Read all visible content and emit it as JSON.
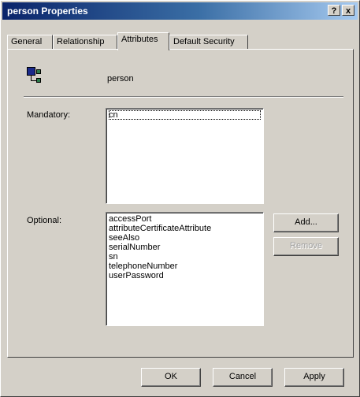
{
  "window": {
    "title": "person Properties",
    "help_button": "?",
    "close_button": "x"
  },
  "tabs": [
    {
      "label": "General"
    },
    {
      "label": "Relationship"
    },
    {
      "label": "Attributes"
    },
    {
      "label": "Default Security"
    }
  ],
  "active_tab": "Attributes",
  "class_name": "person",
  "mandatory": {
    "label": "Mandatory:",
    "items": [
      "cn"
    ]
  },
  "optional": {
    "label": "Optional:",
    "items": [
      "accessPort",
      "attributeCertificateAttribute",
      "seeAlso",
      "serialNumber",
      "sn",
      "telephoneNumber",
      "userPassword"
    ]
  },
  "buttons": {
    "add": "Add...",
    "remove": "Remove",
    "ok": "OK",
    "cancel": "Cancel",
    "apply": "Apply"
  },
  "icons": {
    "title_help": "help-icon",
    "title_close": "close-icon",
    "class": "class-object-icon"
  }
}
